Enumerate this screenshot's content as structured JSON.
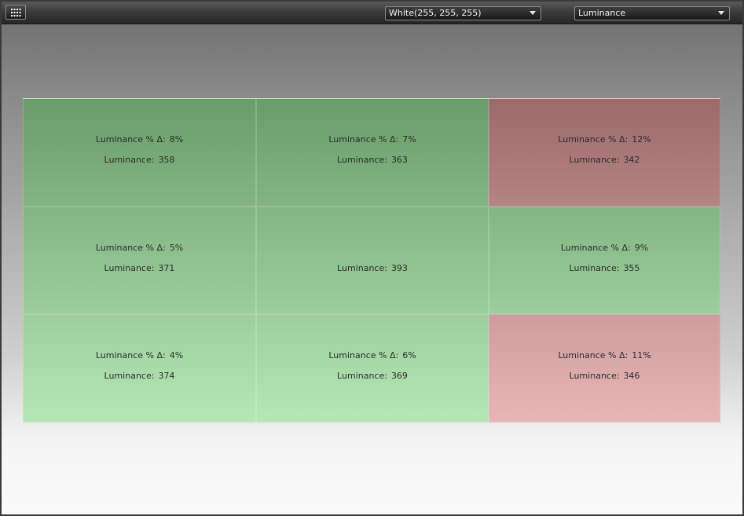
{
  "toolbar": {
    "color_selection": "White(255, 255, 255)",
    "metric_selection": "Luminance",
    "grid_button_icon": "grid-icon"
  },
  "cells": [
    {
      "row": 0,
      "col": 0,
      "delta_label": "Luminance % Δ:",
      "delta_value": "8%",
      "value_label": "Luminance:",
      "value": "358",
      "status": "pass"
    },
    {
      "row": 0,
      "col": 1,
      "delta_label": "Luminance % Δ:",
      "delta_value": "7%",
      "value_label": "Luminance:",
      "value": "363",
      "status": "pass"
    },
    {
      "row": 0,
      "col": 2,
      "delta_label": "Luminance % Δ:",
      "delta_value": "12%",
      "value_label": "Luminance:",
      "value": "342",
      "status": "fail"
    },
    {
      "row": 1,
      "col": 0,
      "delta_label": "Luminance % Δ:",
      "delta_value": "5%",
      "value_label": "Luminance:",
      "value": "371",
      "status": "pass"
    },
    {
      "row": 1,
      "col": 1,
      "delta_label": "",
      "delta_value": "",
      "value_label": "Luminance:",
      "value": "393",
      "status": "reference"
    },
    {
      "row": 1,
      "col": 2,
      "delta_label": "Luminance % Δ:",
      "delta_value": "9%",
      "value_label": "Luminance:",
      "value": "355",
      "status": "pass"
    },
    {
      "row": 2,
      "col": 0,
      "delta_label": "Luminance % Δ:",
      "delta_value": "4%",
      "value_label": "Luminance:",
      "value": "374",
      "status": "pass"
    },
    {
      "row": 2,
      "col": 1,
      "delta_label": "Luminance % Δ:",
      "delta_value": "6%",
      "value_label": "Luminance:",
      "value": "369",
      "status": "pass"
    },
    {
      "row": 2,
      "col": 2,
      "delta_label": "Luminance % Δ:",
      "delta_value": "11%",
      "value_label": "Luminance:",
      "value": "346",
      "status": "fail"
    }
  ],
  "colors": {
    "pass_top": "#6a9c6a",
    "pass_bottom": "#b6e8b6",
    "fail_top": "#9c6a6a",
    "fail_bottom": "#e8b6b6"
  }
}
